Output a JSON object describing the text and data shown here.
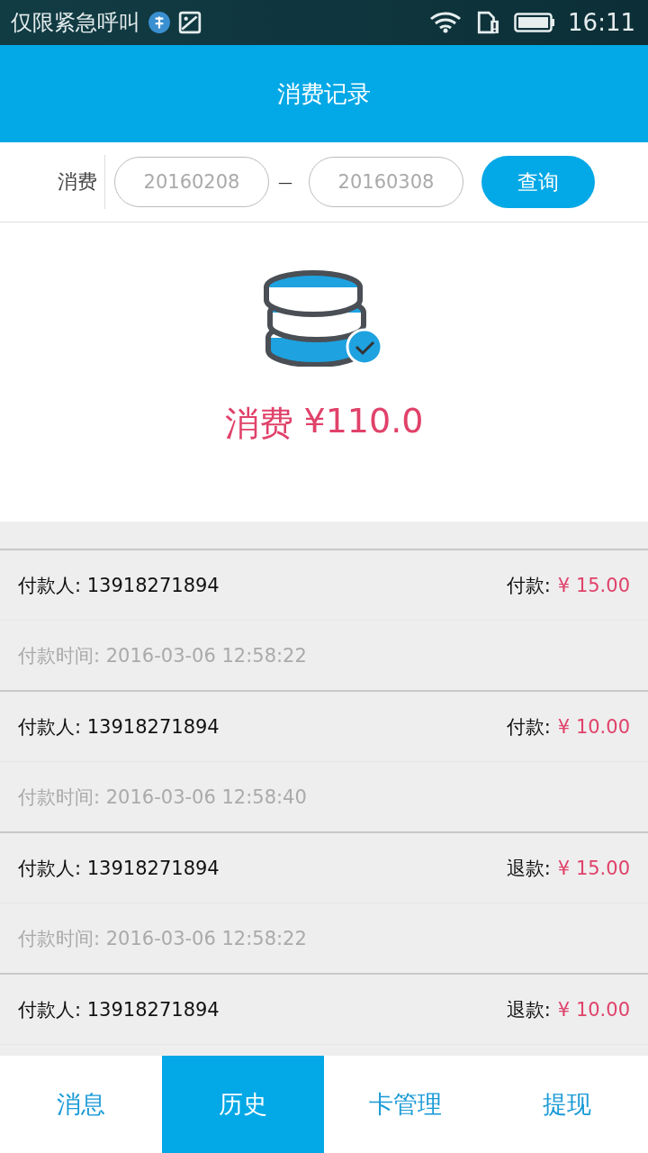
{
  "status_bar": {
    "carrier": "仅限紧急呼叫",
    "time": "16:11"
  },
  "header": {
    "title": "消费记录"
  },
  "filter": {
    "label": "消费",
    "start": "20160208",
    "separator": "—",
    "end": "20160308",
    "button": "查询"
  },
  "summary": {
    "label": "消费",
    "amount": "¥110.0"
  },
  "records": [
    {
      "payer": "付款人: 13918271894",
      "type": "付款:",
      "amount": "¥ 15.00",
      "time": "付款时间: 2016-03-06 12:58:22"
    },
    {
      "payer": "付款人: 13918271894",
      "type": "付款:",
      "amount": "¥ 10.00",
      "time": "付款时间: 2016-03-06 12:58:40"
    },
    {
      "payer": "付款人: 13918271894",
      "type": "退款:",
      "amount": "¥ 15.00",
      "time": "付款时间: 2016-03-06 12:58:22"
    },
    {
      "payer": "付款人: 13918271894",
      "type": "退款:",
      "amount": "¥ 10.00"
    }
  ],
  "tabs": [
    {
      "label": "消息",
      "selected": false
    },
    {
      "label": "历史",
      "selected": true
    },
    {
      "label": "卡管理",
      "selected": false
    },
    {
      "label": "提现",
      "selected": false
    }
  ]
}
